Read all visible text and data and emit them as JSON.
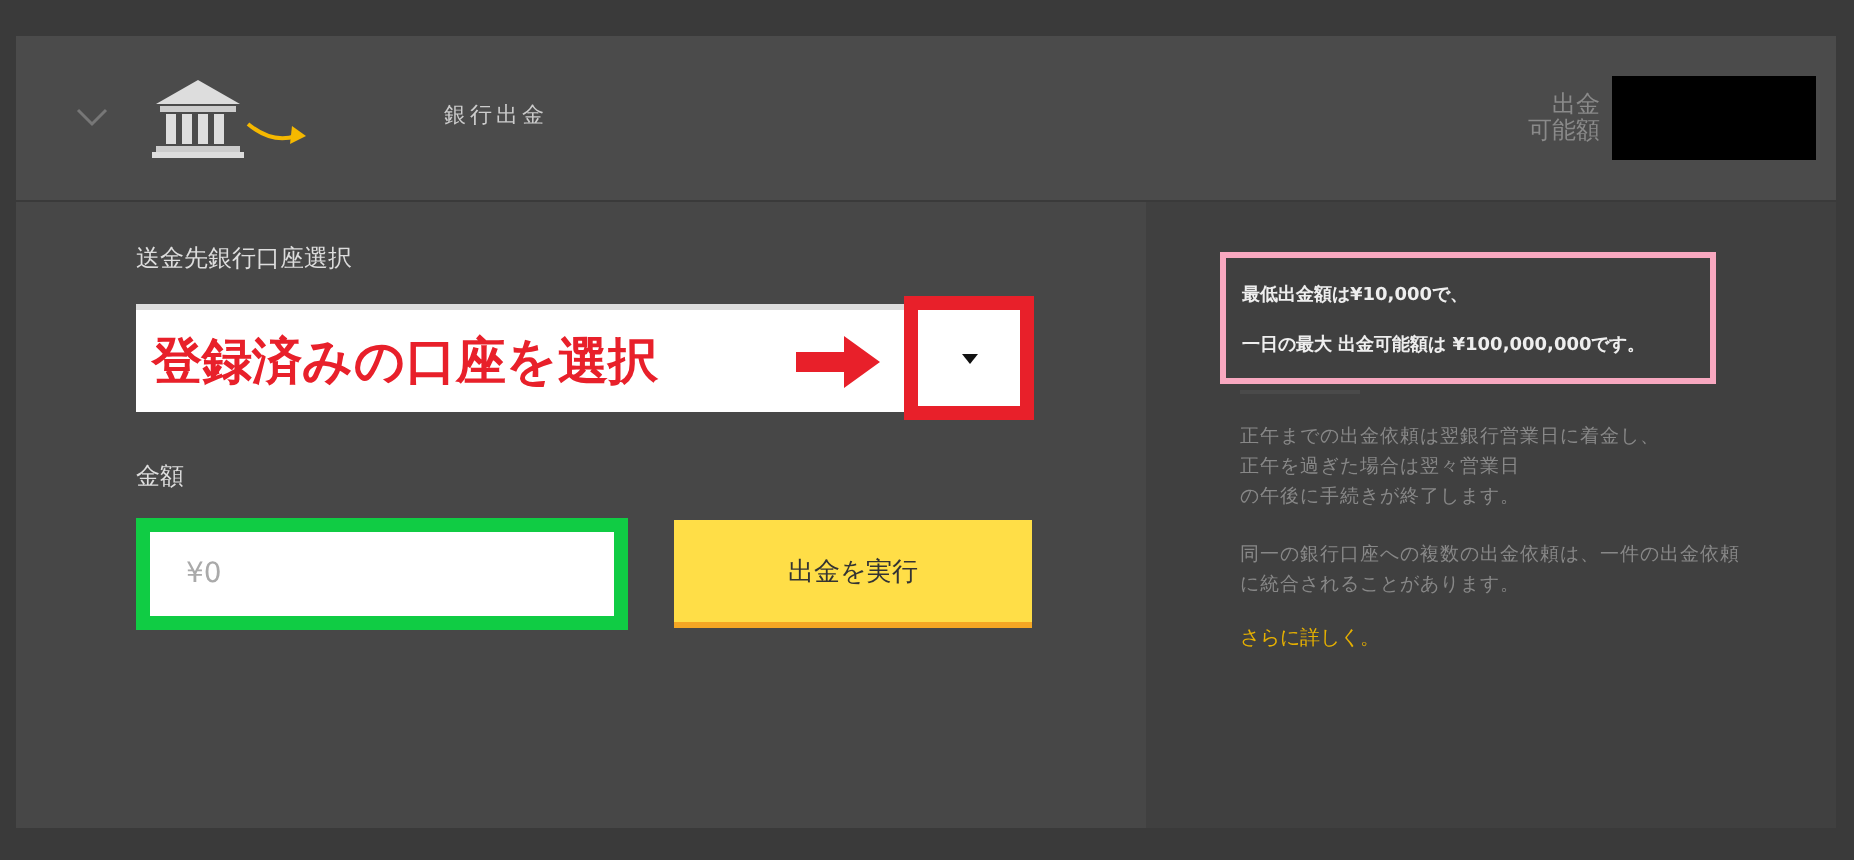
{
  "header": {
    "expanded": true,
    "title": "銀行出金",
    "balance_label": [
      "出金",
      "可能額"
    ]
  },
  "form": {
    "account_label": "送金先銀行口座選択",
    "account_value": "登録済みの口座を選択",
    "amount_label": "金額",
    "amount_placeholder": "¥0",
    "submit": "出金を実行"
  },
  "info": {
    "limits": [
      "最低出金額は¥10,000で、",
      "一日の最大 出金可能額は ¥100,000,000です。"
    ],
    "notes": [
      [
        "正午までの出金依頼は翌銀行営業日に着金し、",
        "正午を過ぎた場合は翌々営業日",
        "の午後に手続きが終了します。"
      ],
      [
        "同一の銀行口座への複数の出金依頼は、一件の出金依頼",
        "に統合されることがあります。"
      ]
    ],
    "link": "さらに詳しく。"
  }
}
